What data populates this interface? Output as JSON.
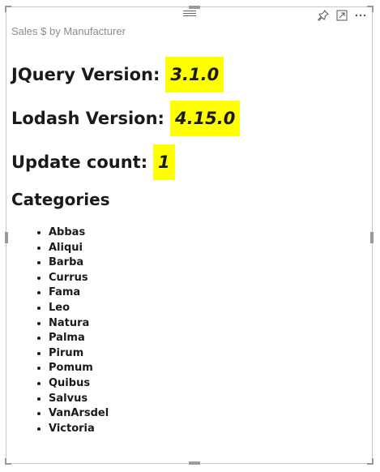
{
  "visual": {
    "title": "Sales $ by Manufacturer",
    "header_icons": [
      "pin-icon",
      "focus-mode-icon",
      "more-options-icon"
    ]
  },
  "info_rows": [
    {
      "label": "JQuery Version:",
      "value": "3.1.0"
    },
    {
      "label": "Lodash Version:",
      "value": "4.15.0"
    },
    {
      "label": "Update count:",
      "value": "1"
    }
  ],
  "categories": {
    "heading": "Categories",
    "items": [
      "Abbas",
      "Aliqui",
      "Barba",
      "Currus",
      "Fama",
      "Leo",
      "Natura",
      "Palma",
      "Pirum",
      "Pomum",
      "Quibus",
      "Salvus",
      "VanArsdel",
      "Victoria"
    ]
  },
  "colors": {
    "highlight": "#ffff00",
    "title_text": "#8c8c8c",
    "frame_border": "#c8c8c8"
  }
}
